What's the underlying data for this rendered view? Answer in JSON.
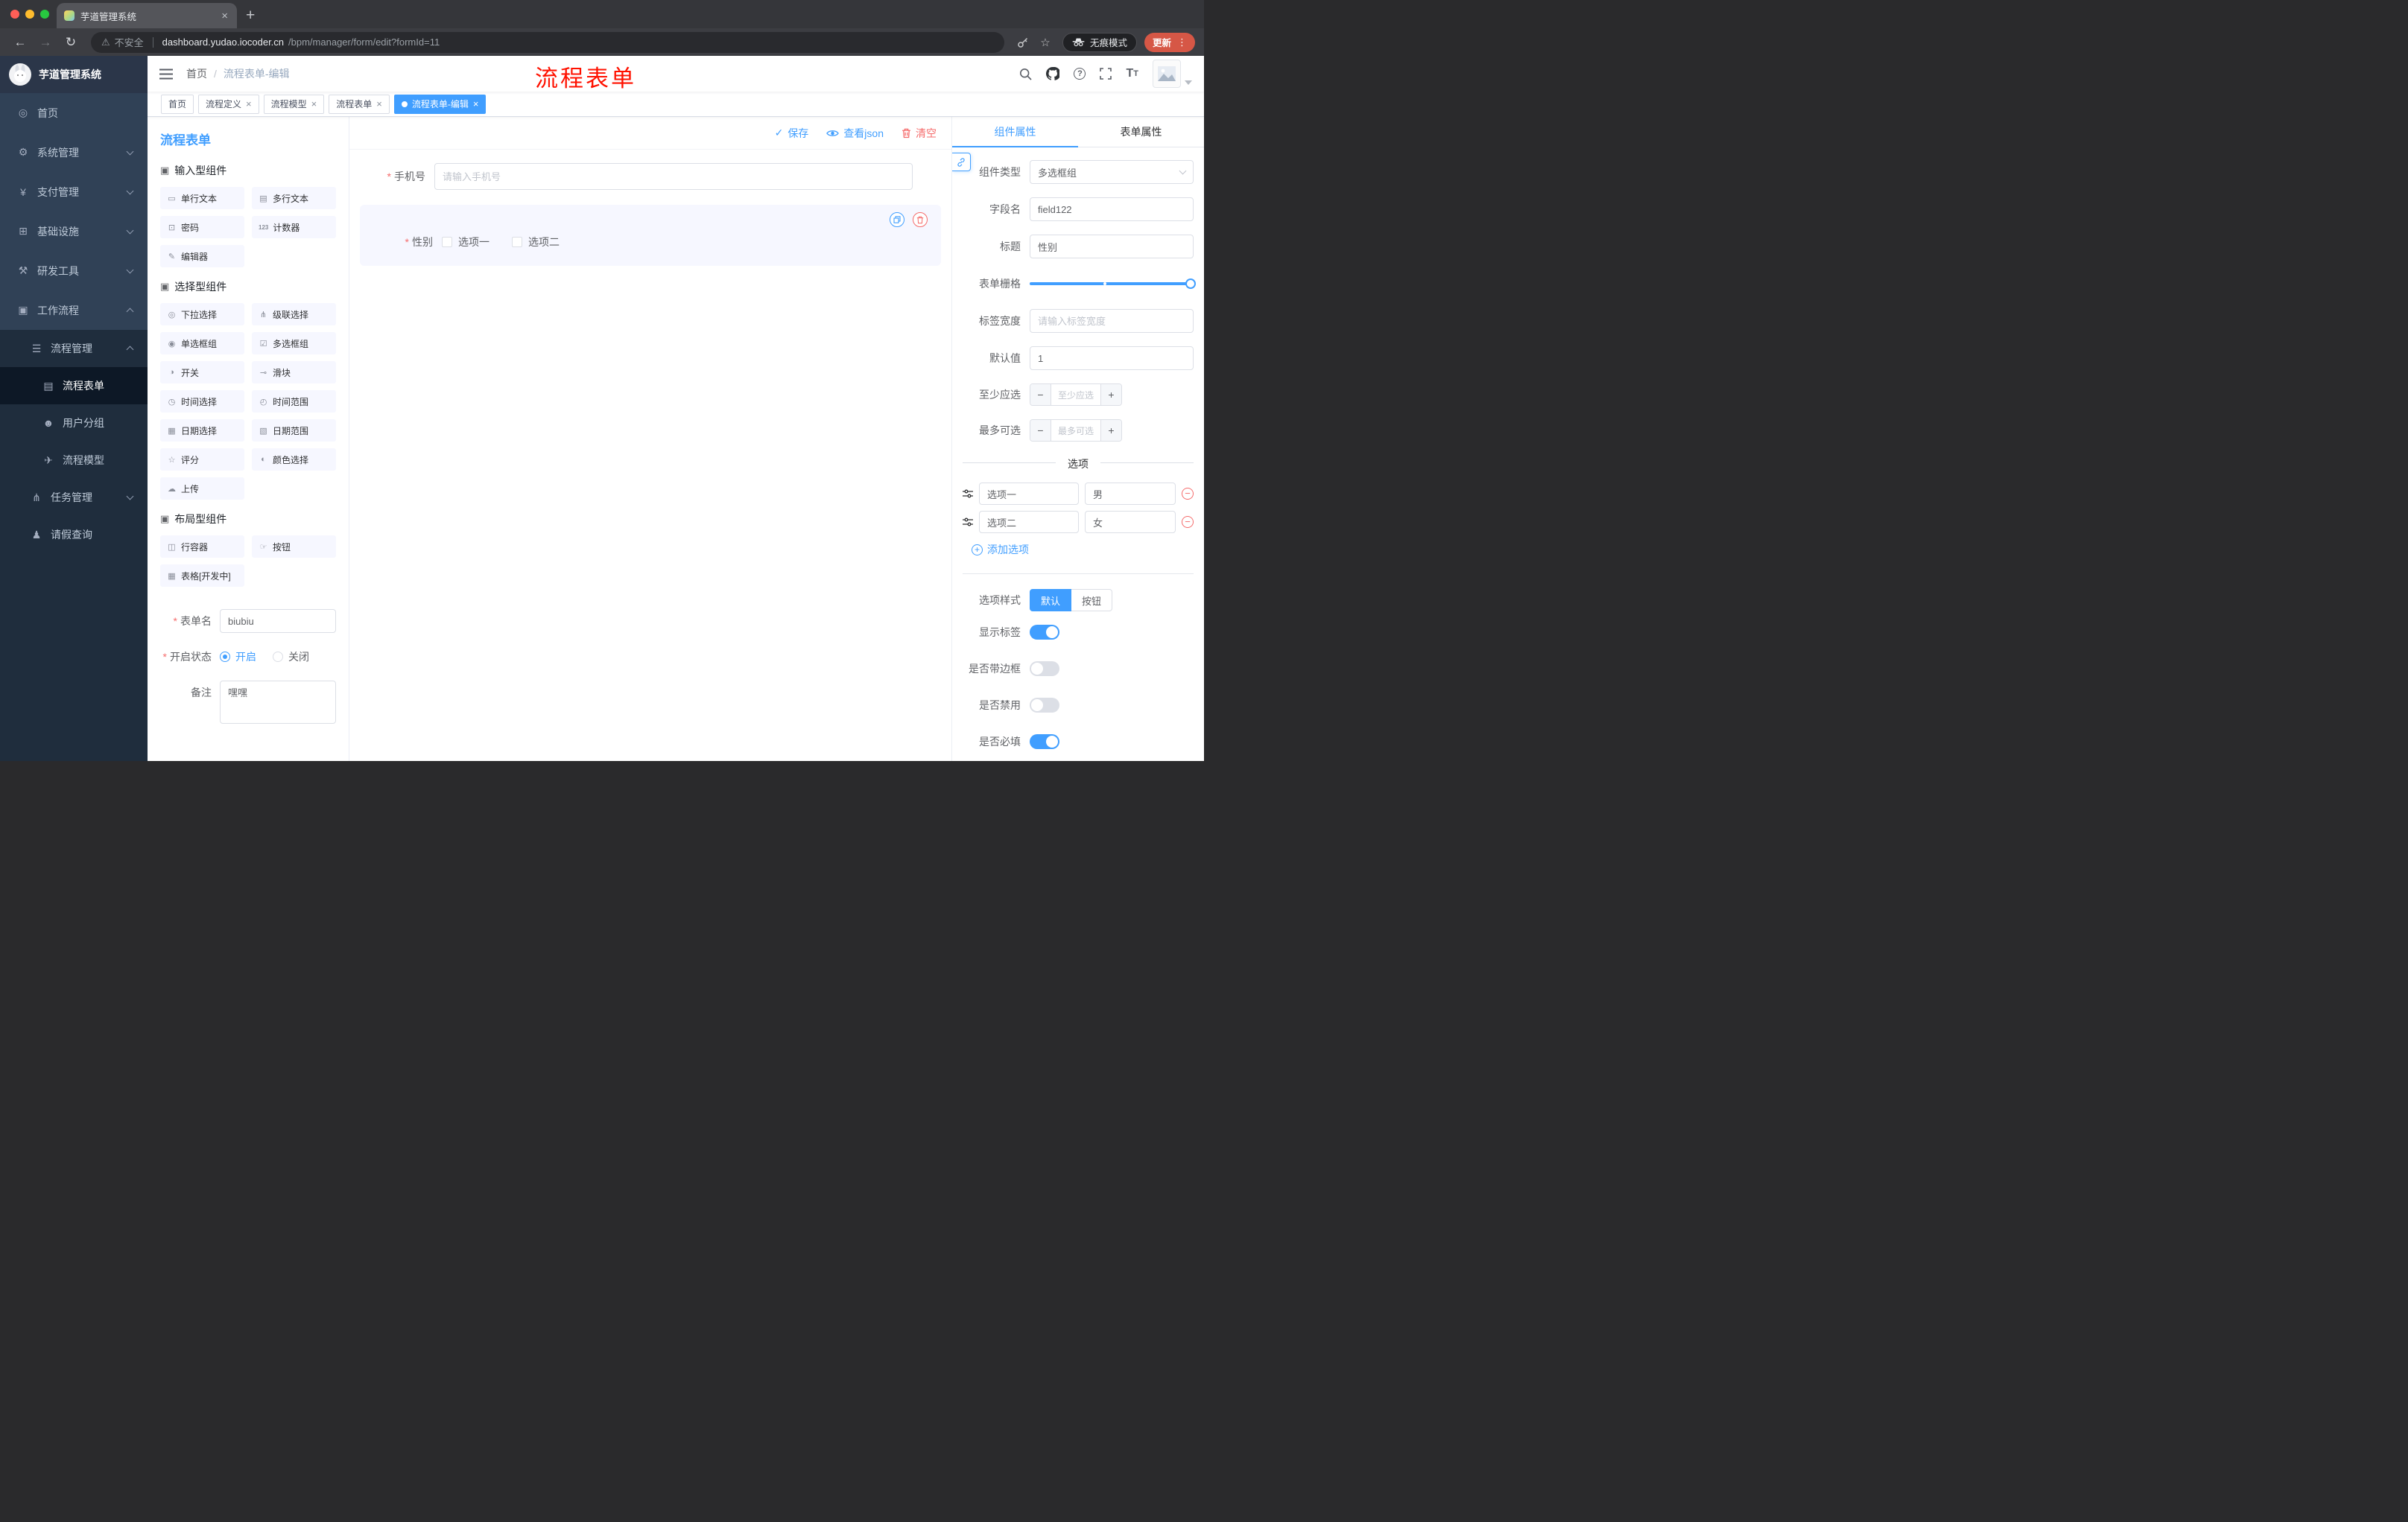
{
  "browser": {
    "tab_title": "芋道管理系统",
    "security_label": "不安全",
    "url_host": "dashboard.yudao.iocoder.cn",
    "url_path": "/bpm/manager/form/edit?formId=11",
    "star_icon": "☆",
    "incognito_label": "无痕模式",
    "update_label": "更新",
    "kebab": "⋮",
    "back": "←",
    "forward": "→",
    "reload": "↻",
    "warn": "⚠",
    "new_tab": "+",
    "close_tab": "×"
  },
  "sidebar": {
    "app_title": "芋道管理系统",
    "menu": [
      {
        "label": "首页",
        "icon": "◎"
      },
      {
        "label": "系统管理",
        "icon": "⚙"
      },
      {
        "label": "支付管理",
        "icon": "¥"
      },
      {
        "label": "基础设施",
        "icon": "⊞"
      },
      {
        "label": "研发工具",
        "icon": "⚒"
      },
      {
        "label": "工作流程",
        "icon": "▣"
      }
    ],
    "submenu": [
      {
        "label": "流程管理",
        "icon": "☰"
      },
      {
        "label": "流程表单",
        "icon": "▤"
      },
      {
        "label": "用户分组",
        "icon": "☻"
      },
      {
        "label": "流程模型",
        "icon": "✈"
      },
      {
        "label": "任务管理",
        "icon": "⋔"
      },
      {
        "label": "请假查询",
        "icon": "♟"
      }
    ]
  },
  "header": {
    "breadcrumb_home": "首页",
    "breadcrumb_sep": "/",
    "breadcrumb_current": "流程表单-编辑",
    "annotation": "流程表单",
    "font_big": "T",
    "font_small": "T",
    "question": "?"
  },
  "tags": [
    {
      "label": "首页"
    },
    {
      "label": "流程定义"
    },
    {
      "label": "流程模型"
    },
    {
      "label": "流程表单"
    },
    {
      "label": "流程表单-编辑"
    }
  ],
  "tag_close": "×",
  "designer": {
    "panel_title": "流程表单",
    "actions": {
      "save_icon": "✓",
      "save": "保存",
      "view_json": "查看json",
      "clear": "清空"
    },
    "group_icon": "▣",
    "groups": [
      {
        "title": "输入型组件",
        "items": [
          {
            "icon": "▭",
            "label": "单行文本"
          },
          {
            "icon": "▤",
            "label": "多行文本"
          },
          {
            "icon": "⊡",
            "label": "密码"
          },
          {
            "icon": "123",
            "label": "计数器"
          },
          {
            "icon": "✎",
            "label": "编辑器"
          }
        ]
      },
      {
        "title": "选择型组件",
        "items": [
          {
            "icon": "◎",
            "label": "下拉选择"
          },
          {
            "icon": "⋔",
            "label": "级联选择"
          },
          {
            "icon": "◉",
            "label": "单选框组"
          },
          {
            "icon": "☑",
            "label": "多选框组"
          },
          {
            "icon": "◑",
            "label": "开关"
          },
          {
            "icon": "⊸",
            "label": "滑块"
          },
          {
            "icon": "◷",
            "label": "时间选择"
          },
          {
            "icon": "◴",
            "label": "时间范围"
          },
          {
            "icon": "▦",
            "label": "日期选择"
          },
          {
            "icon": "▧",
            "label": "日期范围"
          },
          {
            "icon": "☆",
            "label": "评分"
          },
          {
            "icon": "◐",
            "label": "颜色选择"
          },
          {
            "icon": "☁",
            "label": "上传"
          }
        ]
      },
      {
        "title": "布局型组件",
        "items": [
          {
            "icon": "◫",
            "label": "行容器"
          },
          {
            "icon": "☞",
            "label": "按钮"
          },
          {
            "icon": "▦",
            "label": "表格[开发中]"
          }
        ]
      }
    ],
    "meta": {
      "name_label": "表单名",
      "name_value": "biubiu",
      "status_label": "开启状态",
      "status_on": "开启",
      "status_off": "关闭",
      "remark_label": "备注",
      "remark_value": "嘿嘿"
    },
    "canvas": {
      "phone_label": "手机号",
      "phone_placeholder": "请输入手机号",
      "gender_label": "性别",
      "gender_opt1": "选项一",
      "gender_opt2": "选项二"
    }
  },
  "props": {
    "tab_component": "组件属性",
    "tab_form": "表单属性",
    "component_type_label": "组件类型",
    "component_type_value": "多选框组",
    "field_name_label": "字段名",
    "field_name_value": "field122",
    "title_label": "标题",
    "title_value": "性别",
    "grid_label": "表单栅格",
    "label_width_label": "标签宽度",
    "label_width_placeholder": "请输入标签宽度",
    "default_label": "默认值",
    "default_value": "1",
    "min_label": "至少应选",
    "min_placeholder": "至少应选",
    "max_label": "最多可选",
    "max_placeholder": "最多可选",
    "minus": "−",
    "plus": "+",
    "options_title": "选项",
    "options": [
      {
        "label": "选项一",
        "value": "男"
      },
      {
        "label": "选项二",
        "value": "女"
      }
    ],
    "remove_glyph": "−",
    "add_glyph": "+",
    "add_option": "添加选项",
    "style_label": "选项样式",
    "style_default": "默认",
    "style_button": "按钮",
    "toggle_show_label": "显示标签",
    "toggle_border": "是否带边框",
    "toggle_disabled": "是否禁用",
    "toggle_required": "是否必填"
  },
  "colors": {
    "primary": "#409eff",
    "danger": "#f56c6c",
    "annotation": "#ff1100"
  }
}
